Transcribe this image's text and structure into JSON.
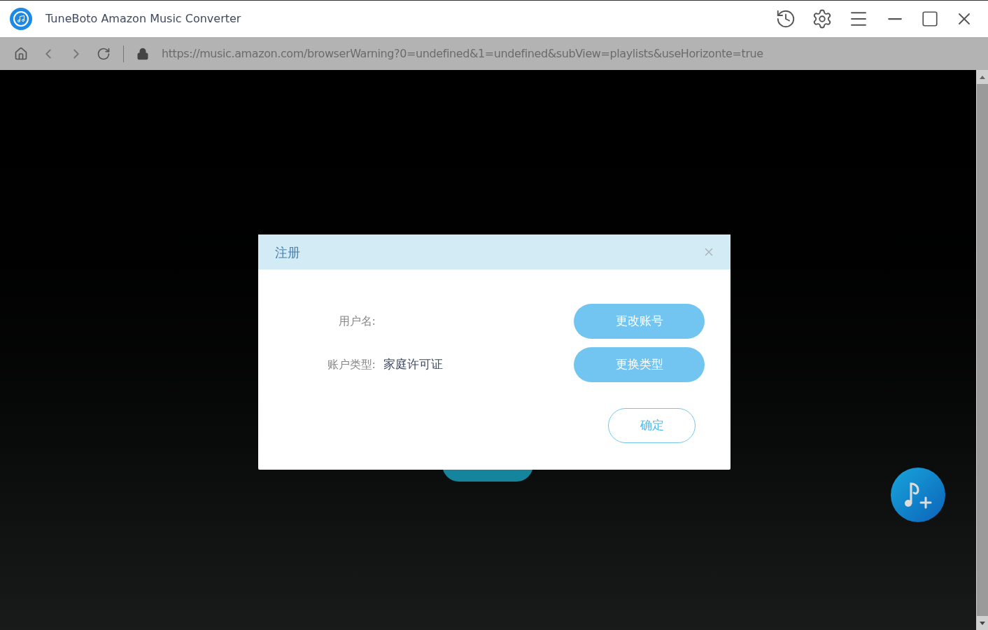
{
  "window": {
    "title": "TuneBoto Amazon Music Converter"
  },
  "address_bar": {
    "url": "https://music.amazon.com/browserWarning?0=undefined&1=undefined&subView=playlists&useHorizonte=true"
  },
  "dialog": {
    "title": "注册",
    "fields": [
      {
        "label": "用户名:"
      },
      {
        "label": "账户类型:",
        "value": "家庭许可证"
      }
    ],
    "buttons": [
      {
        "label": "更改账号",
        "kind": "filled"
      },
      {
        "label": "更换类型",
        "kind": "filled"
      },
      {
        "label": "确定",
        "kind": "outline"
      }
    ]
  }
}
